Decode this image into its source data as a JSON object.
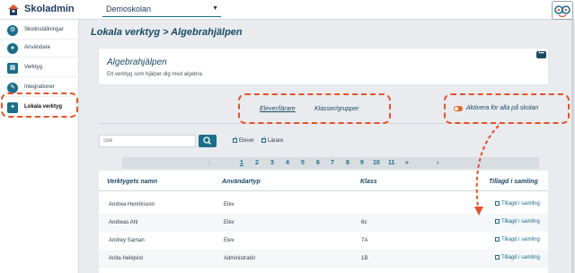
{
  "app": {
    "name": "Skoladmin",
    "school": "Demoskolan"
  },
  "sidebar": {
    "items": [
      {
        "label": "Skolinställningar",
        "icon": "gear-icon"
      },
      {
        "label": "Användare",
        "icon": "user-icon"
      },
      {
        "label": "Verktyg",
        "icon": "grid-icon"
      },
      {
        "label": "Integrationer",
        "icon": "wrench-icon"
      },
      {
        "label": "Lokala verktyg",
        "icon": "puzzle-icon"
      }
    ]
  },
  "page": {
    "title": "Lokala verktyg > Algebrahjälpen"
  },
  "tool": {
    "title": "Algebrahjälpen",
    "description": "Ett verktyg som hjälper dig med algebra."
  },
  "tabs": {
    "students_teachers": "Elever/lärare",
    "classes_groups": "Klasser/grupper",
    "activate_all": "Aktivera för alla på skolan"
  },
  "search": {
    "placeholder": "Sök"
  },
  "filters": {
    "students": "Elever",
    "teachers": "Lärare"
  },
  "pagination": {
    "prev": "‹",
    "pages": [
      "1",
      "2",
      "3",
      "4",
      "5",
      "6",
      "7",
      "8",
      "9",
      "10",
      "11"
    ],
    "more": "»",
    "next": "›"
  },
  "table": {
    "headers": {
      "name": "Verktygets namn",
      "usertype": "Användartyp",
      "class": "Klass",
      "added": "Tillagd i samling"
    },
    "rows": [
      {
        "name": "Andrea Henriksson",
        "usertype": "Elev",
        "class": "",
        "added": "Tillagd i samling"
      },
      {
        "name": "Andreas Ahl",
        "usertype": "Elev",
        "class": "6c",
        "added": "Tillagd i samling"
      },
      {
        "name": "Andrey Saman",
        "usertype": "Elev",
        "class": "7A",
        "added": "Tillagd i samling"
      },
      {
        "name": "Anita Hellqvist",
        "usertype": "Administratör",
        "class": "1B",
        "added": "Tillagd i samling"
      }
    ]
  },
  "colors": {
    "accent": "#1b6e8a",
    "annotation": "#e5522a",
    "title": "#1b4964"
  }
}
